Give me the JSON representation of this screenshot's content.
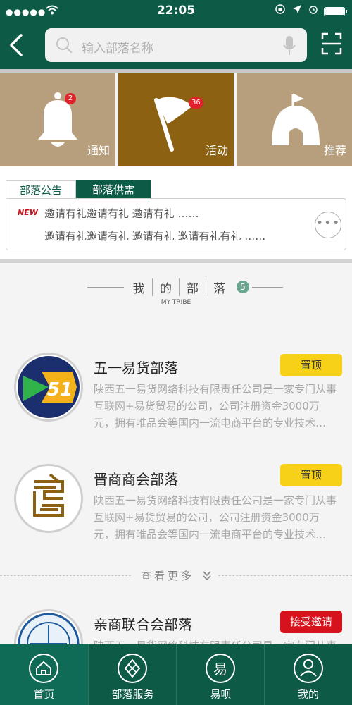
{
  "status_bar": {
    "time": "22:05",
    "signal": "●●●●●"
  },
  "search": {
    "placeholder": "输入部落名称"
  },
  "tiles": [
    {
      "label": "通知",
      "badge": "2",
      "icon": "bell-icon"
    },
    {
      "label": "活动",
      "badge": "36",
      "icon": "flag-icon"
    },
    {
      "label": "推荐",
      "icon": "tent-icon"
    }
  ],
  "announcements": {
    "tabs": [
      "部落公告",
      "部落供需"
    ],
    "new_tag": "NEW",
    "lines": [
      "邀请有礼邀请有礼 邀请有礼 ……",
      "邀请有礼邀请有礼 邀请有礼 邀请有礼有礼 ……"
    ],
    "more_label": "•••"
  },
  "my_tribe": {
    "title_chars": [
      "我",
      "的",
      "部",
      "落"
    ],
    "count": "5",
    "subtitle": "MY TRIBE"
  },
  "tribes": [
    {
      "name": "五一易货部落",
      "desc": "陕西五一易货网络科技有限责任公司是一家专门从事互联网+易货贸易的公司，公司注册资金3000万元，拥有唯品会等国内一流电商平台的专业技术…",
      "action": "置顶",
      "logo_text": "51"
    },
    {
      "name": "晋商商会部落",
      "desc": "陕西五一易货网络科技有限责任公司是一家专门从事互联网+易货贸易的公司，公司注册资金3000万元，拥有唯品会等国内一流电商平台的专业技术…",
      "action": "置顶"
    },
    {
      "name": "亲商联合会部落",
      "desc": "陕西五一易货网络科技有限责任公司是一家专门从事",
      "action": "接受邀请"
    }
  ],
  "see_more": "查看更多",
  "bottom_nav": [
    {
      "label": "首页",
      "icon": "home-icon"
    },
    {
      "label": "部落服务",
      "icon": "service-icon"
    },
    {
      "label": "易呗",
      "icon": "yibei-icon"
    },
    {
      "label": "我的",
      "icon": "user-icon"
    }
  ],
  "colors": {
    "brand": "#0d5a47",
    "tile": "#b79f7d",
    "tile_active": "#8c6212",
    "pin": "#f7d117",
    "accept": "#d6121c"
  }
}
